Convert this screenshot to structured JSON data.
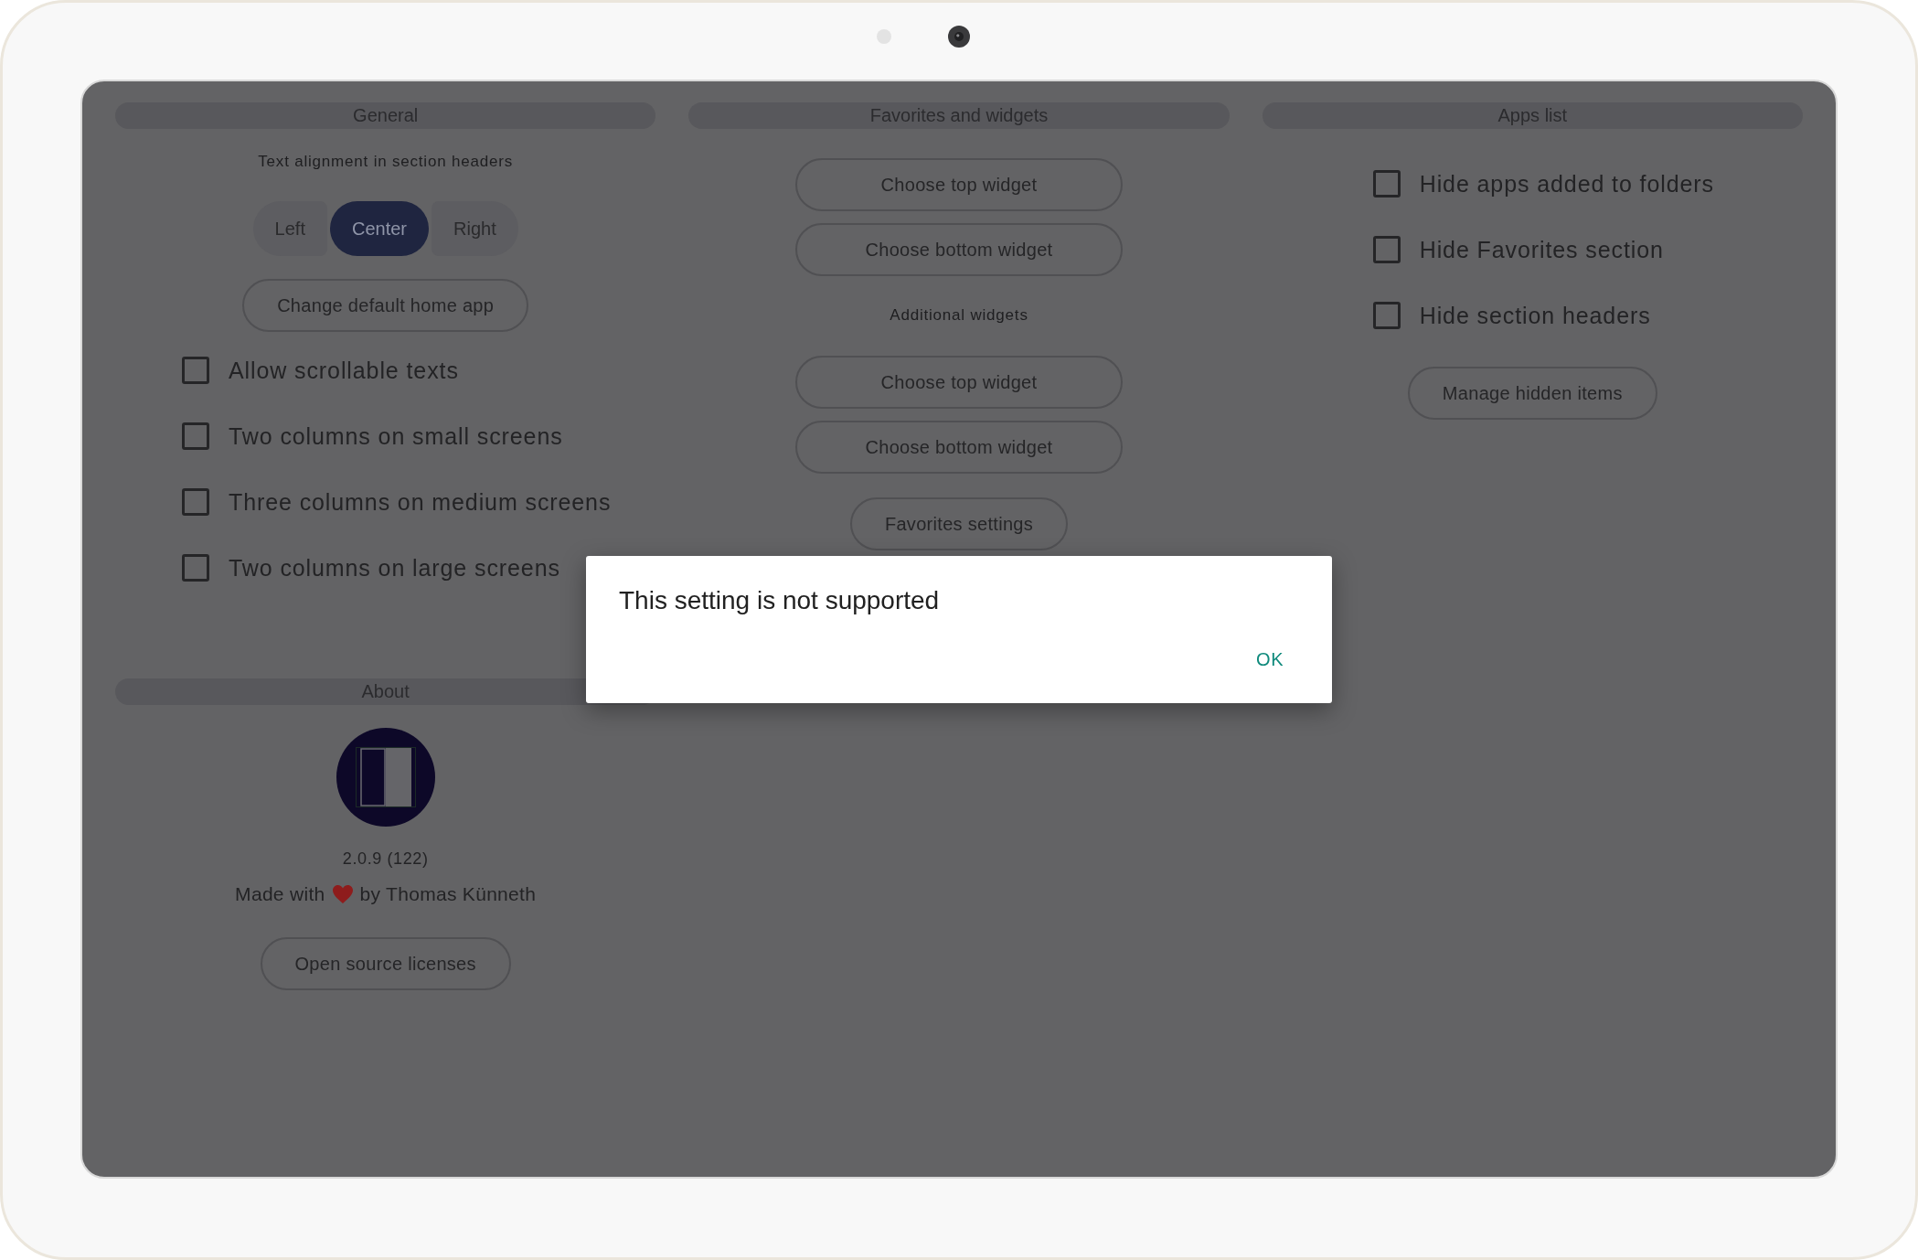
{
  "general": {
    "title": "General",
    "alignment_label": "Text alignment in section headers",
    "alignment_options": [
      {
        "label": "Left",
        "selected": false
      },
      {
        "label": "Center",
        "selected": true
      },
      {
        "label": "Right",
        "selected": false
      }
    ],
    "button": "Change default home app",
    "options": [
      {
        "label": "Allow scrollable texts",
        "checked": false
      },
      {
        "label": "Two columns on small screens",
        "checked": false
      },
      {
        "label": "Three columns on medium screens",
        "checked": false
      },
      {
        "label": "Two columns on large screens",
        "checked": false
      }
    ]
  },
  "favorites_and_widgets": {
    "title": "Favorites and widgets",
    "buttons": [
      "Choose top widget",
      "Choose bottom widget"
    ],
    "additional_label": "Additional widgets",
    "additional_buttons": [
      "Choose top widget",
      "Choose bottom widget"
    ],
    "settings_button": "Favorites settings"
  },
  "apps_list": {
    "title": "Apps list",
    "options": [
      {
        "label": "Hide apps added to folders",
        "checked": false
      },
      {
        "label": "Hide Favorites section",
        "checked": false
      },
      {
        "label": "Hide section headers",
        "checked": false
      }
    ],
    "button": "Manage hidden items"
  },
  "about": {
    "title": "About",
    "version": "2.0.9 (122)",
    "credit_prefix": "Made with",
    "credit_suffix": "by Thomas Künneth",
    "button": "Open source licenses"
  },
  "dialog": {
    "message": "This setting is not supported",
    "button": "OK"
  }
}
